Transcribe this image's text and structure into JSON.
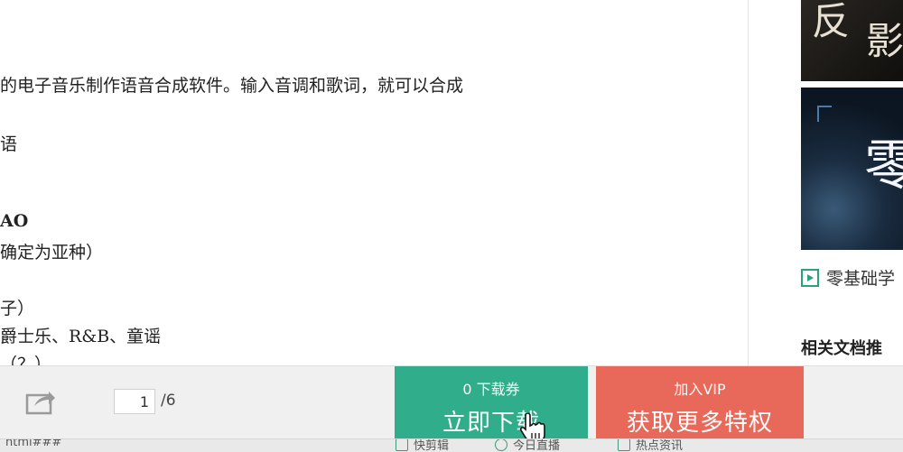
{
  "document": {
    "lines": [
      {
        "text": "的电子音乐制作语音合成软件。输入音调和歌词，就可以合成",
        "bold": false
      },
      {
        "text": "语",
        "bold": false
      },
      {
        "text": "AO",
        "bold": true
      },
      {
        "text": "确定为亚种）",
        "bold": false
      },
      {
        "text": "子）",
        "bold": false
      },
      {
        "text": "爵士乐、R&B、童谣",
        "bold": false
      },
      {
        "text": "（？）",
        "bold": false
      }
    ]
  },
  "sidebar": {
    "thumb1_chars": [
      "反",
      "影"
    ],
    "thumb2_char": "零",
    "video_label": "零基础学",
    "related_title": "相关文档推"
  },
  "bottom": {
    "page_current": "1",
    "page_total": "/6",
    "download_sub": "0 下载券",
    "download_main": "立即下载",
    "vip_sub": "加入VIP",
    "vip_main": "获取更多特权"
  },
  "status": {
    "url": "html###",
    "items": [
      "快剪辑",
      "今日直播",
      "热点资讯"
    ]
  },
  "colors": {
    "download_green": "#30ad8b",
    "vip_red": "#e8685a",
    "icon_green": "#2aa27a"
  },
  "icons": {
    "share": "share-icon",
    "play": "play-icon",
    "cursor": "hand-pointer-icon"
  }
}
